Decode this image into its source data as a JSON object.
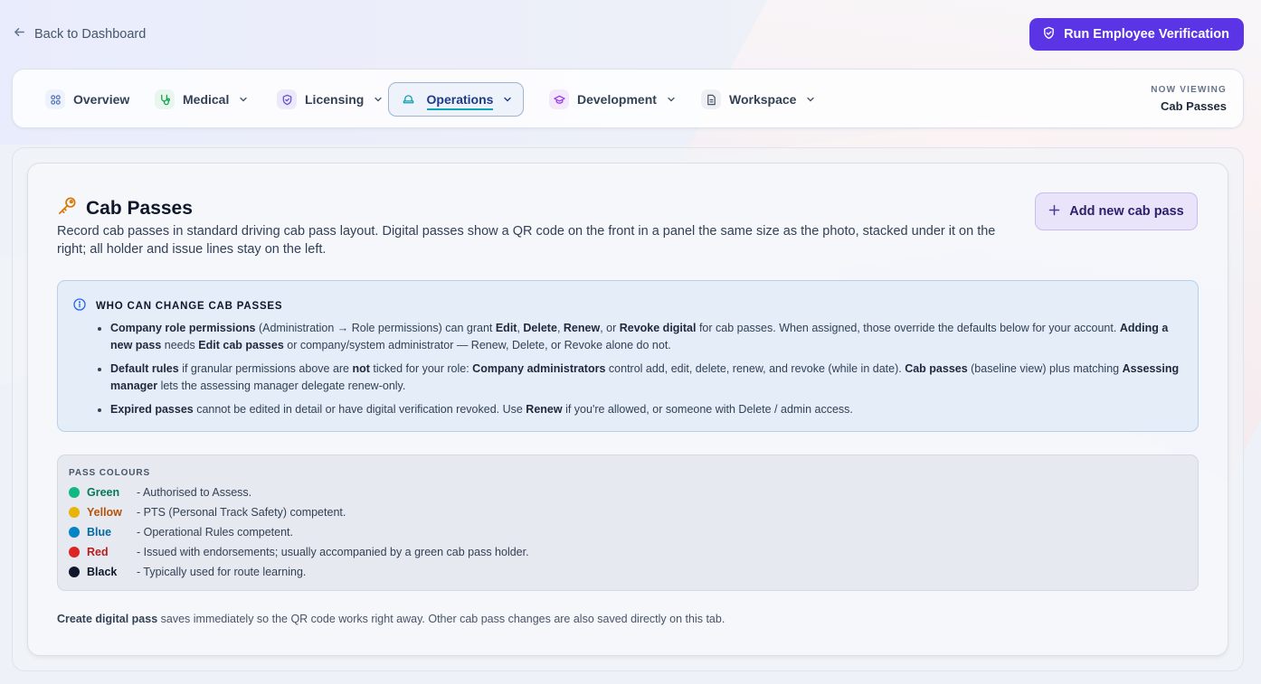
{
  "topbar": {
    "back_label": "Back to Dashboard",
    "verify_label": "Run Employee Verification"
  },
  "nav": {
    "items": [
      {
        "label": "Overview",
        "icon": "grid-icon"
      },
      {
        "label": "Medical",
        "icon": "stethoscope-icon"
      },
      {
        "label": "Licensing",
        "icon": "shield-icon"
      },
      {
        "label": "Operations",
        "icon": "hat-icon"
      },
      {
        "label": "Development",
        "icon": "graduation-cap-icon"
      },
      {
        "label": "Workspace",
        "icon": "document-icon"
      }
    ],
    "active": "Operations",
    "now_viewing_label": "NOW VIEWING",
    "now_viewing_value": "Cab Passes"
  },
  "card": {
    "title": "Cab Passes",
    "description": "Record cab passes in standard driving cab pass layout. Digital passes show a QR code on the front in a panel the same size as the photo, stacked under it on the right; all holder and issue lines stay on the left.",
    "add_label": "Add new cab pass"
  },
  "info": {
    "heading": "WHO CAN CHANGE CAB PASSES",
    "bullets": [
      {
        "t1_b": "Company role permissions",
        "t2": " (Administration → Role permissions) can grant ",
        "t3_b": "Edit",
        "t4": ", ",
        "t5_b": "Delete",
        "t6": ", ",
        "t7_b": "Renew",
        "t8": ", or ",
        "t9_b": "Revoke digital",
        "t10": " for cab passes. When assigned, those override the defaults below for your account. ",
        "t11_b": "Adding a new pass",
        "t12": " needs ",
        "t13_b": "Edit cab passes",
        "t14": " or company/system administrator — Renew, Delete, or Revoke alone do not."
      },
      {
        "t1_b": "Default rules",
        "t2": " if granular permissions above are ",
        "t3_b": "not",
        "t4": " ticked for your role: ",
        "t5_b": "Company administrators",
        "t6": " control add, edit, delete, renew, and revoke (while in date). ",
        "t7_b": "Cab passes",
        "t8": " (baseline view) plus matching ",
        "t9_b": "Assessing manager",
        "t10": " lets the assessing manager delegate renew-only."
      },
      {
        "t1_b": "Expired passes",
        "t2": " cannot be edited in detail or have digital verification revoked. Use ",
        "t3_b": "Renew",
        "t4": " if you're allowed, or someone with Delete / admin access."
      }
    ]
  },
  "colours": {
    "heading": "PASS COLOURS",
    "items": [
      {
        "name": "Green",
        "desc": "- Authorised to Assess.",
        "dot": "#10b981",
        "text": "#047857"
      },
      {
        "name": "Yellow",
        "desc": "- PTS (Personal Track Safety) competent.",
        "dot": "#eab308",
        "text": "#b45309"
      },
      {
        "name": "Blue",
        "desc": "- Operational Rules competent.",
        "dot": "#0284c7",
        "text": "#0369a1"
      },
      {
        "name": "Red",
        "desc": "- Issued with endorsements; usually accompanied by a green cab pass holder.",
        "dot": "#dc2626",
        "text": "#b91c1c"
      },
      {
        "name": "Black",
        "desc": "- Typically used for route learning.",
        "dot": "#0f172a",
        "text": "#0f172a"
      }
    ]
  },
  "footer": {
    "bold": "Create digital pass",
    "rest": " saves immediately so the QR code works right away. Other cab pass changes are also saved directly on this tab."
  }
}
